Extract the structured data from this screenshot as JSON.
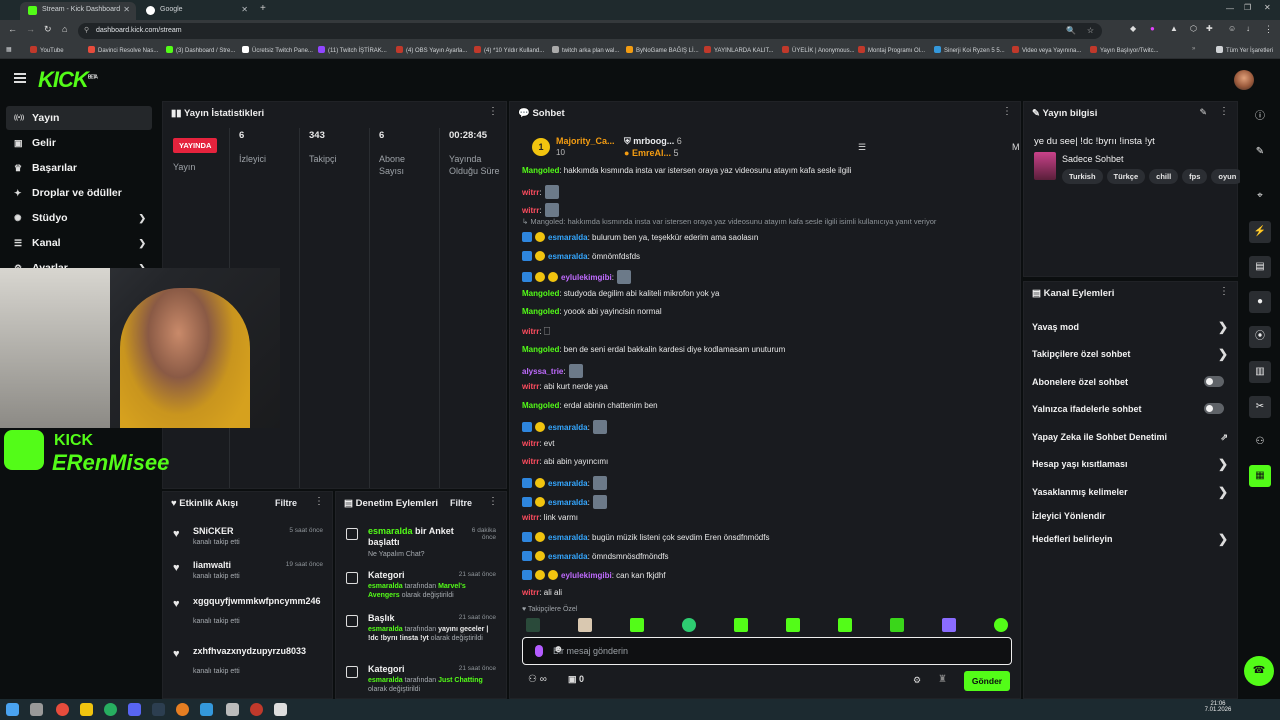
{
  "browser": {
    "tabs": [
      {
        "title": "Stream - Kick Dashboard",
        "active": true
      },
      {
        "title": "Google",
        "active": false
      }
    ],
    "url": "dashboard.kick.com/stream",
    "bookmarks": [
      "YouTube",
      "Davinci Resolve Nas...",
      "(3) Dashboard / Stre...",
      "Ücretsiz Twitch Pane...",
      "(11) Twitch İŞTİRAK...",
      "(4) OBS Yayın Ayarla...",
      "(4) *10 Yıldır Kulland...",
      "twitch arka plan wal...",
      "ByNoGame BAĞIŞ Lİ...",
      "YAYINLARDA KALIT...",
      "ÜYELİK | Anonymous...",
      "Montaj Programı Ol...",
      "Sinerji Koi Ryzen 5 5...",
      "Video veya Yayınına...",
      "Yayın Başlıyor/Twitc..."
    ],
    "bookmarks_all": "Tüm Yer İşaretleri"
  },
  "header": {
    "logo": "KICK",
    "logo_sup": "BETA"
  },
  "sidebar": {
    "items": [
      {
        "label": "Yayın",
        "icon": "broadcast-icon",
        "glyph": "((•))"
      },
      {
        "label": "Gelir",
        "icon": "money-icon",
        "glyph": "▣"
      },
      {
        "label": "Başarılar",
        "icon": "trophy-icon",
        "glyph": "♛"
      },
      {
        "label": "Droplar ve ödüller",
        "icon": "gift-icon",
        "glyph": "✦"
      },
      {
        "label": "Stüdyo",
        "icon": "studio-icon",
        "glyph": "✺"
      },
      {
        "label": "Kanal",
        "icon": "channel-icon",
        "glyph": "☰"
      },
      {
        "label": "Ayarlar",
        "icon": "settings-icon",
        "glyph": "⚙"
      }
    ]
  },
  "stats": {
    "title": "Yayın İstatistikleri",
    "live_badge": "YAYINDA",
    "live_label": "Yayın",
    "items": [
      {
        "value": "6",
        "label": "İzleyici"
      },
      {
        "value": "343",
        "label": "Takipçi"
      },
      {
        "value": "6",
        "label": "Abone Sayısı"
      },
      {
        "value": "00:28:45",
        "label": "Yayında Olduğu Süre"
      }
    ]
  },
  "overlay": {
    "kick": "KICK",
    "name": "ERenMisee"
  },
  "activity": {
    "title": "Etkinlik Akışı",
    "filter": "Filtre",
    "items": [
      {
        "name": "SNiCKER",
        "sub": "kanalı takip etti",
        "time": "5 saat önce"
      },
      {
        "name": "liamwalti",
        "sub": "kanalı takip etti",
        "time": "19 saat önce"
      },
      {
        "name": "xggquyfjwmmkwfpncymm246",
        "sub": "kanalı takip etti",
        "time": "gi"
      },
      {
        "name": "zxhfhvazxnydzupyrzu8033",
        "sub": "kanalı takip etti",
        "time": "gi önc"
      }
    ]
  },
  "moderation": {
    "title": "Denetim Eylemleri",
    "filter": "Filtre",
    "items": [
      {
        "head_user": "esmaralda",
        "head": " bir Anket başlattı",
        "desc": "Ne Yapalım Chat?",
        "time": "6 dakika önce"
      },
      {
        "head": "Kategori",
        "desc_user": "esmaralda",
        "desc_mid": " tarafından ",
        "desc_val": "Marvel's Avengers",
        "desc_end": " olarak değiştirildi",
        "time": "21 saat önce"
      },
      {
        "head": "Başlık",
        "desc_user": "esmaralda",
        "desc_mid": " tarafından ",
        "desc_val": "yayını geceler | !dc !byrıı !insta !yt",
        "desc_end": " olarak değiştirildi",
        "time": "21 saat önce"
      },
      {
        "head": "Kategori",
        "desc_user": "esmaralda",
        "desc_mid": " tarafından ",
        "desc_val": "Just Chatting",
        "desc_end": " olarak değiştirildi",
        "time": "21 saat önce"
      }
    ]
  },
  "chat": {
    "title": "Sohbet",
    "pinned": [
      {
        "name": "Majority_Ca...",
        "count": "10"
      },
      {
        "name": "mrboog...",
        "count": "6"
      },
      {
        "name": "EmreAl...",
        "count": "5"
      }
    ],
    "pinned_letter": "M",
    "reply_line": "↳ Mangoled: hakkımda kısmında insta var istersen oraya yaz videosunu atayım kafa sesle ilgili isimli kullanıcıya yanıt veriyor",
    "messages": [
      {
        "user": "Mangoled",
        "color": "u-green",
        "text": ": hakkımda kısmında insta var istersen oraya yaz videosunu atayım kafa sesle ilgili",
        "badges": 0
      },
      {
        "user": "witrr",
        "color": "u-red",
        "text": ":",
        "badges": 0,
        "emote": true
      },
      {
        "user": "witrr",
        "color": "u-red",
        "text": ":",
        "badges": 0,
        "emote": true
      },
      {
        "user": "esmaralda",
        "color": "u-blue",
        "text": ": bulurum ben ya, teşekkür ederim ama saolasın",
        "badges": 2
      },
      {
        "user": "esmaralda",
        "color": "u-blue",
        "text": ": ömnömfdsfds",
        "badges": 2
      },
      {
        "user": "eylulekimgibi",
        "color": "u-purple",
        "text": ":",
        "badges": 3,
        "emote": true
      },
      {
        "user": "Mangoled",
        "color": "u-green",
        "text": ": studyoda degilim abi kaliteli mikrofon yok ya",
        "badges": 0
      },
      {
        "user": "Mangoled",
        "color": "u-green",
        "text": ": yoook abi yayincisin normal",
        "badges": 0
      },
      {
        "user": "witrr",
        "color": "u-red",
        "text": ": 🗌",
        "badges": 0
      },
      {
        "user": "Mangoled",
        "color": "u-green",
        "text": ": ben de seni erdal bakkalin kardesi diye kodlamasam unuturum",
        "badges": 0
      },
      {
        "user": "alyssa_trie",
        "color": "u-purple",
        "text": ":",
        "badges": 0,
        "emote": true
      },
      {
        "user": "witrr",
        "color": "u-red",
        "text": ": abi kurt nerde yaa",
        "badges": 0
      },
      {
        "user": "Mangoled",
        "color": "u-green",
        "text": ": erdal abinin chattenim ben",
        "badges": 0
      },
      {
        "user": "esmaralda",
        "color": "u-blue",
        "text": ":",
        "badges": 2,
        "emote": true
      },
      {
        "user": "witrr",
        "color": "u-red",
        "text": ": evt",
        "badges": 0
      },
      {
        "user": "witrr",
        "color": "u-red",
        "text": ": abi abin yayıncımı",
        "badges": 0
      },
      {
        "user": "esmaralda",
        "color": "u-blue",
        "text": ":",
        "badges": 2,
        "emote": true
      },
      {
        "user": "esmaralda",
        "color": "u-blue",
        "text": ":",
        "badges": 2,
        "emote": true
      },
      {
        "user": "witrr",
        "color": "u-red",
        "text": ": link varmı",
        "badges": 0
      },
      {
        "user": "esmaralda",
        "color": "u-blue",
        "text": ": bugün müzik listeni çok sevdim Eren önsdfnmödfs",
        "badges": 2
      },
      {
        "user": "esmaralda",
        "color": "u-blue",
        "text": ": ömndsmnösdfmöndfs",
        "badges": 2
      },
      {
        "user": "eylulekimgibi",
        "color": "u-purple",
        "text": ": can kan fkjdhf",
        "badges": 3
      },
      {
        "user": "witrr",
        "color": "u-red",
        "text": ": ali ali",
        "badges": 0
      }
    ],
    "followers_only": "♥ Takipçilere Özel",
    "input_placeholder": "Bir mesaj gönderin",
    "points": "∞",
    "gifts": "0",
    "send": "Gönder"
  },
  "stream_info": {
    "title": "Yayın bilgisi",
    "stream_title": "ye du see| !dc !byrıı !insta !yt",
    "category": "Sadece Sohbet",
    "tags": [
      "Turkish",
      "Türkçe",
      "chill",
      "fps",
      "oyun"
    ]
  },
  "channel_actions": {
    "title": "Kanal Eylemleri",
    "items": [
      {
        "label": "Yavaş mod",
        "type": "chevron"
      },
      {
        "label": "Takipçilere özel sohbet",
        "type": "chevron"
      },
      {
        "label": "Abonelere özel sohbet",
        "type": "toggle"
      },
      {
        "label": "Yalnızca ifadelerle sohbet",
        "type": "toggle"
      },
      {
        "label": "Yapay Zeka ile Sohbet Denetimi",
        "type": "external"
      },
      {
        "label": "Hesap yaşı kısıtlaması",
        "type": "chevron"
      },
      {
        "label": "Yasaklanmış kelimeler",
        "type": "chevron"
      },
      {
        "label": "İzleyici Yönlendir",
        "type": "none"
      },
      {
        "label": "Hedefleri belirleyin",
        "type": "chevron"
      }
    ]
  },
  "taskbar": {
    "time": "21:06",
    "date": "7.01.2026"
  },
  "colors": {
    "accent": "#53fc18",
    "live": "#e5233d",
    "panel": "#191b1f"
  }
}
